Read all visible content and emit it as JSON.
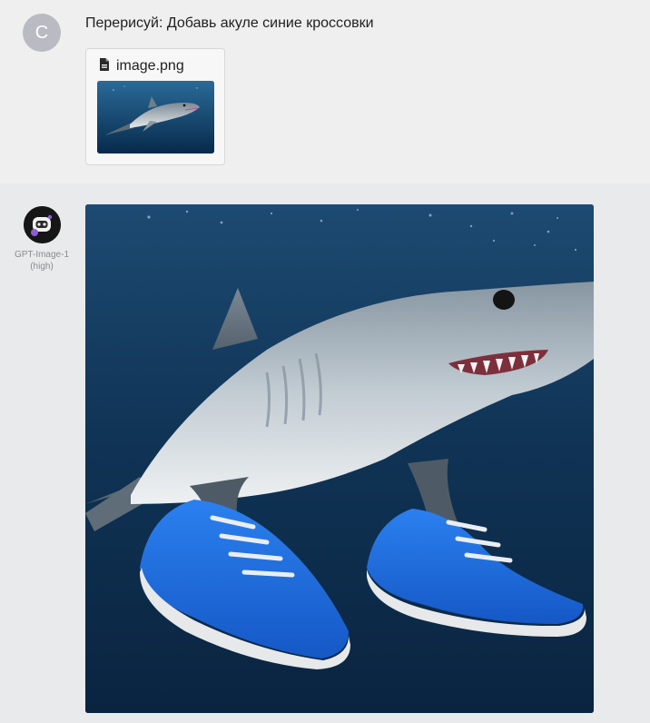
{
  "user": {
    "avatar_letter": "C",
    "message": "Перерисуй: Добавь акуле синие кроссовки",
    "attachment": {
      "icon": "file-icon",
      "file_name": "image.png"
    }
  },
  "assistant": {
    "model_name": "GPT-Image-1",
    "model_variant": "(high)"
  },
  "colors": {
    "user_turn_bg": "#efefef",
    "assistant_turn_bg": "#e9eaec",
    "user_avatar_bg": "#b9bac2",
    "shoe_blue": "#1f6fe0",
    "water_dark": "#0e2b4a"
  }
}
